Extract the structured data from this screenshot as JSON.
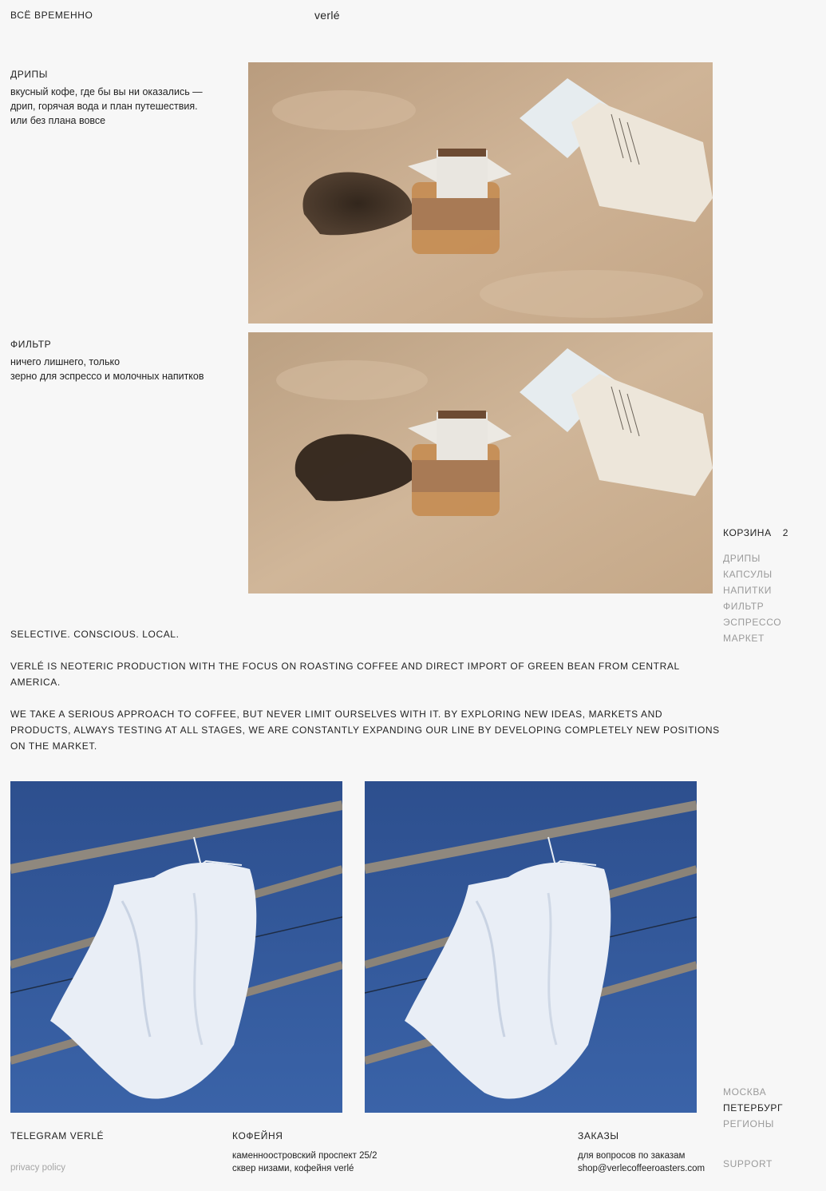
{
  "header": {
    "left_link": "ВСЁ ВРЕМЕННО",
    "logo": "verlé"
  },
  "sections": [
    {
      "title": "ДРИПЫ",
      "lines": [
        "вкусный кофе, где бы вы ни оказались —",
        "дрип, горячая вода и план путешествия.",
        "или без плана вовсе"
      ]
    },
    {
      "title": "ФИЛЬТР",
      "lines": [
        "ничего лишнего, только",
        "зерно для эспрессо и молочных напитков"
      ]
    }
  ],
  "cart": {
    "label": "КОРЗИНА",
    "count": "2"
  },
  "side_nav": [
    "ДРИПЫ",
    "КАПСУЛЫ",
    "НАПИТКИ",
    "ФИЛЬТР",
    "ЭСПРЕССО",
    "МАРКЕТ"
  ],
  "about": {
    "tagline": "SELECTIVE. CONSCIOUS. LOCAL.",
    "p1": "VERLÉ IS NEOTERIC PRODUCTION WITH THE FOCUS ON ROASTING COFFEE AND DIRECT IMPORT OF GREEN BEAN FROM CENTRAL AMERICA.",
    "p2": "WE TAKE A SERIOUS APPROACH TO COFFEE, BUT NEVER LIMIT OURSELVES WITH IT. BY EXPLORING NEW IDEAS, MARKETS AND PRODUCTS, ALWAYS TESTING AT ALL STAGES, WE ARE CONSTANTLY EXPANDING OUR LINE BY DEVELOPING COMPLETELY NEW POSITIONS ON THE MARKET."
  },
  "cities": [
    {
      "label": "МОСКВА",
      "active": false
    },
    {
      "label": "ПЕТЕРБУРГ",
      "active": true
    },
    {
      "label": "РЕГИОНЫ",
      "active": false
    }
  ],
  "footer": {
    "telegram": "TELEGRAM VERLÉ",
    "privacy": "privacy policy",
    "cafe_title": "КОФЕЙНЯ",
    "cafe_line1": "каменноостровский проспект 25/2",
    "cafe_line2": "сквер низами, кофейня verlé",
    "orders_title": "ЗАКАЗЫ",
    "orders_line1": "для вопросов по заказам",
    "orders_email": "shop@verlecoffeeroasters.com",
    "support": "SUPPORT"
  },
  "colors": {
    "background": "#f7f7f7",
    "text": "#222222",
    "muted": "#9a9a9a",
    "sand": "#c9ad8f",
    "sky": "#2e5496"
  }
}
